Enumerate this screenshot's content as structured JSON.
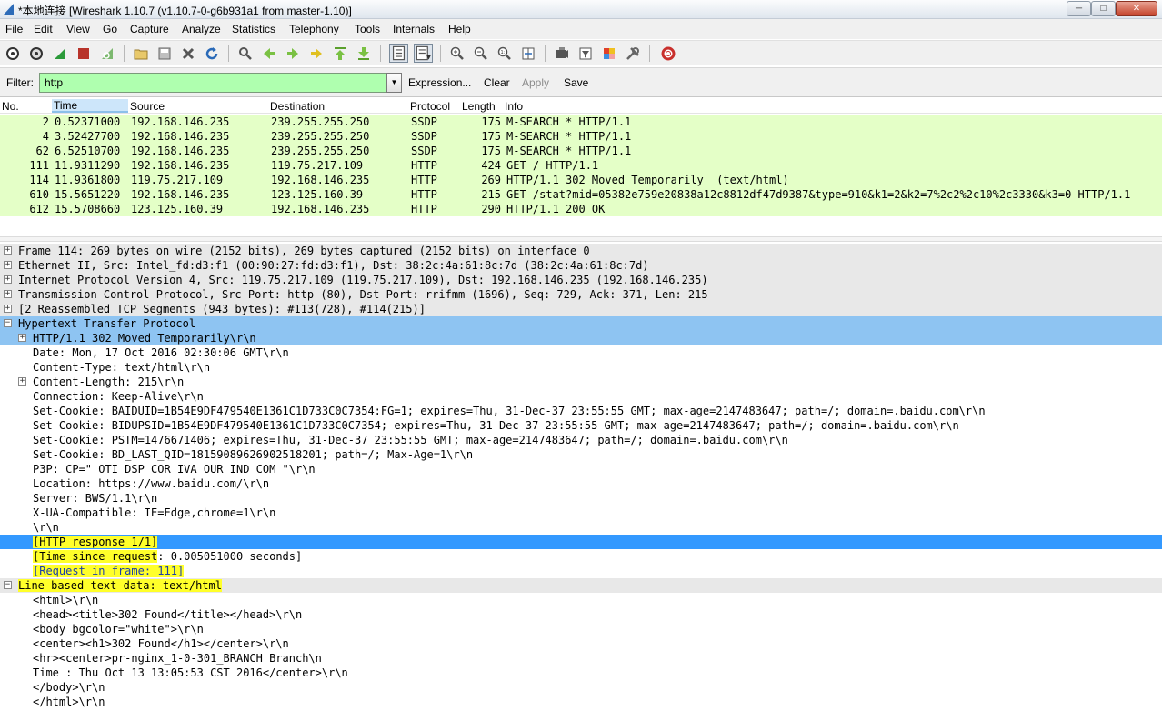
{
  "window": {
    "title": "*本地连接   [Wireshark 1.10.7  (v1.10.7-0-g6b931a1 from master-1.10)]",
    "min_glyph": "─",
    "max_glyph": "□",
    "close_glyph": "✕"
  },
  "menu": [
    "File",
    "Edit",
    "View",
    "Go",
    "Capture",
    "Analyze",
    "Statistics",
    "Telephony",
    "Tools",
    "Internals",
    "Help"
  ],
  "toolbar_icons": [
    "interface-list-icon",
    "capture-options-icon",
    "start-capture-icon",
    "stop-capture-icon",
    "restart-capture-icon",
    "open-file-icon",
    "save-file-icon",
    "close-file-icon",
    "reload-icon",
    "find-packet-icon",
    "go-back-icon",
    "go-forward-icon",
    "go-to-packet-icon",
    "go-first-icon",
    "go-last-icon",
    "colorize-icon",
    "autoscroll-icon",
    "zoom-in-icon",
    "zoom-out-icon",
    "zoom-normal-icon",
    "resize-columns-icon",
    "capture-filters-icon",
    "display-filters-icon",
    "coloring-rules-icon",
    "preferences-icon",
    "help-icon"
  ],
  "filter": {
    "label": "Filter:",
    "value": "http",
    "dropdown_glyph": "▼",
    "expression": "Expression...",
    "clear": "Clear",
    "apply": "Apply",
    "save": "Save"
  },
  "packet_list": {
    "columns": [
      "No.",
      "Time",
      "Source",
      "Destination",
      "Protocol",
      "Length",
      "Info"
    ],
    "rows": [
      {
        "no": "2",
        "time": "0.52371000",
        "src": "192.168.146.235",
        "dst": "239.255.255.250",
        "proto": "SSDP",
        "len": "175",
        "info": "M-SEARCH * HTTP/1.1"
      },
      {
        "no": "4",
        "time": "3.52427700",
        "src": "192.168.146.235",
        "dst": "239.255.255.250",
        "proto": "SSDP",
        "len": "175",
        "info": "M-SEARCH * HTTP/1.1"
      },
      {
        "no": "62",
        "time": "6.52510700",
        "src": "192.168.146.235",
        "dst": "239.255.255.250",
        "proto": "SSDP",
        "len": "175",
        "info": "M-SEARCH * HTTP/1.1"
      },
      {
        "no": "111",
        "time": "11.9311290",
        "src": "192.168.146.235",
        "dst": "119.75.217.109",
        "proto": "HTTP",
        "len": "424",
        "info": "GET / HTTP/1.1"
      },
      {
        "no": "114",
        "time": "11.9361800",
        "src": "119.75.217.109",
        "dst": "192.168.146.235",
        "proto": "HTTP",
        "len": "269",
        "info": "HTTP/1.1 302 Moved Temporarily  (text/html)"
      },
      {
        "no": "610",
        "time": "15.5651220",
        "src": "192.168.146.235",
        "dst": "123.125.160.39",
        "proto": "HTTP",
        "len": "215",
        "info": "GET /stat?mid=05382e759e20838a12c8812df47d9387&type=910&k1=2&k2=7%2c2%2c10%2c3330&k3=0 HTTP/1.1"
      },
      {
        "no": "612",
        "time": "15.5708660",
        "src": "123.125.160.39",
        "dst": "192.168.146.235",
        "proto": "HTTP",
        "len": "290",
        "info": "HTTP/1.1 200 OK"
      }
    ]
  },
  "details": {
    "expand_glyph": "+",
    "collapse_glyph": "−",
    "lines": [
      {
        "text": "Frame 114: 269 bytes on wire (2152 bits), 269 bytes captured (2152 bits) on interface 0",
        "toggle": "+",
        "style": "hdr"
      },
      {
        "text": "Ethernet II, Src: Intel_fd:d3:f1 (00:90:27:fd:d3:f1), Dst: 38:2c:4a:61:8c:7d (38:2c:4a:61:8c:7d)",
        "toggle": "+",
        "style": "hdr"
      },
      {
        "text": "Internet Protocol Version 4, Src: 119.75.217.109 (119.75.217.109), Dst: 192.168.146.235 (192.168.146.235)",
        "toggle": "+",
        "style": "hdr"
      },
      {
        "text": "Transmission Control Protocol, Src Port: http (80), Dst Port: rrifmm (1696), Seq: 729, Ack: 371, Len: 215",
        "toggle": "+",
        "style": "hdr"
      },
      {
        "text": "[2 Reassembled TCP Segments (943 bytes): #113(728), #114(215)]",
        "toggle": "+",
        "style": "hdr"
      },
      {
        "text": "Hypertext Transfer Protocol",
        "toggle": "-",
        "style": "sel2"
      },
      {
        "text": "HTTP/1.1 302 Moved Temporarily\\r\\n",
        "toggle": "+",
        "style": "sel2",
        "indent": 1
      },
      {
        "text": "Date: Mon, 17 Oct 2016 02:30:06 GMT\\r\\n",
        "indent": 1
      },
      {
        "text": "Content-Type: text/html\\r\\n",
        "indent": 1
      },
      {
        "text": "Content-Length: 215\\r\\n",
        "toggle": "+",
        "indent": 1
      },
      {
        "text": "Connection: Keep-Alive\\r\\n",
        "indent": 1
      },
      {
        "text": "Set-Cookie: BAIDUID=1B54E9DF479540E1361C1D733C0C7354:FG=1; expires=Thu, 31-Dec-37 23:55:55 GMT; max-age=2147483647; path=/; domain=.baidu.com\\r\\n",
        "indent": 1
      },
      {
        "text": "Set-Cookie: BIDUPSID=1B54E9DF479540E1361C1D733C0C7354; expires=Thu, 31-Dec-37 23:55:55 GMT; max-age=2147483647; path=/; domain=.baidu.com\\r\\n",
        "indent": 1
      },
      {
        "text": "Set-Cookie: PSTM=1476671406; expires=Thu, 31-Dec-37 23:55:55 GMT; max-age=2147483647; path=/; domain=.baidu.com\\r\\n",
        "indent": 1
      },
      {
        "text": "Set-Cookie: BD_LAST_QID=18159089626902518201; path=/; Max-Age=1\\r\\n",
        "indent": 1
      },
      {
        "text": "P3P: CP=\" OTI DSP COR IVA OUR IND COM \"\\r\\n",
        "indent": 1
      },
      {
        "text": "Location: https://www.baidu.com/\\r\\n",
        "indent": 1
      },
      {
        "text": "Server: BWS/1.1\\r\\n",
        "indent": 1
      },
      {
        "text": "X-UA-Compatible: IE=Edge,chrome=1\\r\\n",
        "indent": 1
      },
      {
        "text": "\\r\\n",
        "indent": 1
      },
      {
        "text": "[HTTP response 1/1]",
        "indent": 1,
        "style": "sel",
        "highlight": true
      },
      {
        "text": "[Time since request: 0.005051000 seconds]",
        "indent": 1,
        "highlight_prefix": "[Time since request",
        "rest": ": 0.005051000 seconds]"
      },
      {
        "text": "[Request in frame: 111]",
        "indent": 1,
        "highlight": true,
        "link": true
      },
      {
        "text": "Line-based text data: text/html",
        "toggle": "-",
        "style": "hdr",
        "highlight": true
      },
      {
        "text": "<html>\\r\\n",
        "indent": 1
      },
      {
        "text": "<head><title>302 Found</title></head>\\r\\n",
        "indent": 1
      },
      {
        "text": "<body bgcolor=\"white\">\\r\\n",
        "indent": 1
      },
      {
        "text": "<center><h1>302 Found</h1></center>\\r\\n",
        "indent": 1
      },
      {
        "text": "<hr><center>pr-nginx_1-0-301_BRANCH Branch\\n",
        "indent": 1
      },
      {
        "text": "Time : Thu Oct 13 13:05:53 CST 2016</center>\\r\\n",
        "indent": 1
      },
      {
        "text": "</body>\\r\\n",
        "indent": 1
      },
      {
        "text": "</html>\\r\\n",
        "indent": 1
      }
    ]
  },
  "colors": {
    "ssdp_http_row": "#e4ffc7",
    "selected": "#3399ff",
    "protocol_selected": "#8ec4f2",
    "filter_valid": "#afffaf",
    "annotation_highlight": "#ffff2a"
  }
}
